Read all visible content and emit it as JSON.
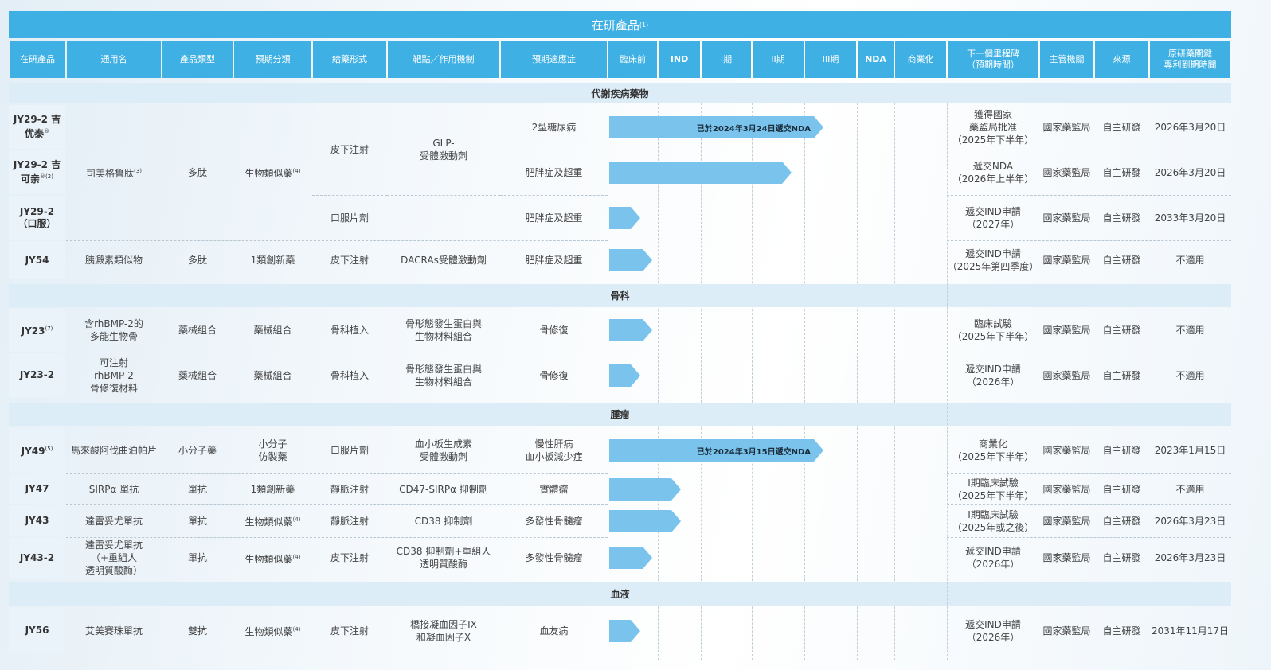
{
  "title": "在研產品",
  "title_note": "(1)",
  "headers": [
    "在研產品",
    "通用名",
    "產品類型",
    "預期分類",
    "給藥形式",
    "靶點／作用機制",
    "預期適應症",
    "臨床前",
    "IND",
    "I期",
    "II期",
    "III期",
    "NDA",
    "商業化",
    "下一個里程碑\n（預期時間）",
    "主管機關",
    "來源",
    "原研藥關鍵\n專利到期時間"
  ],
  "sections": [
    {
      "name": "代謝疾病藥物",
      "rows": [
        {
          "code": "JY29-2\n吉优泰",
          "code_sup": "®",
          "generic": "",
          "type": "",
          "class": "",
          "class_sup": "",
          "route": "",
          "target": "",
          "indication": "2型糖尿病",
          "arrow_text": "已於2024年3月24日遞交NDA",
          "progress": 0.75,
          "milestone": "獲得國家\n藥監局批准\n（2025年下半年）",
          "authority": "國家藥監局",
          "source": "自主研發",
          "patent": "2026年3月20日"
        },
        {
          "code": "JY29-2\n吉可亲",
          "code_sup": "®(2)",
          "generic": "司美格鲁肽",
          "generic_sup": "(3)",
          "type": "多肽",
          "class": "生物類似藥",
          "class_sup": "(4)",
          "route": "皮下注射",
          "target": "GLP-\n受體激動劑",
          "indication": "肥胖症及超重",
          "arrow_text": "",
          "progress": 0.64,
          "milestone": "遞交NDA\n（2026年上半年）",
          "authority": "國家藥監局",
          "source": "自主研發",
          "patent": "2026年3月20日"
        },
        {
          "code": "JY29-2\n（口服）",
          "code_sup": "",
          "generic": "",
          "type": "",
          "class": "",
          "class_sup": "",
          "route": "口服片劑",
          "target": "",
          "indication": "肥胖症及超重",
          "arrow_text": "",
          "progress": 0.11,
          "milestone": "遞交IND申請\n（2027年）",
          "authority": "國家藥監局",
          "source": "自主研發",
          "patent": "2033年3月20日"
        },
        {
          "code": "JY54",
          "code_sup": "",
          "generic": "胰澱素類似物",
          "type": "多肽",
          "class": "1類創新藥",
          "class_sup": "",
          "route": "皮下注射",
          "target": "DACRAs受體激動劑",
          "indication": "肥胖症及超重",
          "arrow_text": "",
          "progress": 0.15,
          "milestone": "遞交IND申請\n（2025年第四季度）",
          "authority": "國家藥監局",
          "source": "自主研發",
          "patent": "不適用"
        }
      ]
    },
    {
      "name": "骨科",
      "rows": [
        {
          "code": "JY23",
          "code_sup": "(7)",
          "generic": "含rhBMP-2的\n多能生物骨",
          "type": "藥械組合",
          "class": "藥械組合",
          "class_sup": "",
          "route": "骨科植入",
          "target": "骨形態發生蛋白與\n生物材料組合",
          "indication": "骨修復",
          "arrow_text": "",
          "progress": 0.15,
          "milestone": "臨床試驗\n（2025年下半年）",
          "authority": "國家藥監局",
          "source": "自主研發",
          "patent": "不適用"
        },
        {
          "code": "JY23-2",
          "code_sup": "",
          "generic": "可注射\nrhBMP-2\n骨修復材料",
          "type": "藥械組合",
          "class": "藥械組合",
          "class_sup": "",
          "route": "骨科植入",
          "target": "骨形態發生蛋白與\n生物材料組合",
          "indication": "骨修復",
          "arrow_text": "",
          "progress": 0.11,
          "milestone": "遞交IND申請\n（2026年）",
          "authority": "國家藥監局",
          "source": "自主研發",
          "patent": "不適用"
        }
      ]
    },
    {
      "name": "腫瘤",
      "rows": [
        {
          "code": "JY49",
          "code_sup": "(5)",
          "generic": "馬來酸阿伐曲泊帕片",
          "type": "小分子藥",
          "class": "小分子\n仿製藥",
          "class_sup": "",
          "route": "口服片劑",
          "target": "血小板生成素\n受體激動劑",
          "indication": "慢性肝病\n血小板減少症",
          "arrow_text": "已於2024年3月15日遞交NDA",
          "progress": 0.75,
          "milestone": "商業化\n（2025年下半年）",
          "authority": "國家藥監局",
          "source": "自主研發",
          "patent": "2023年1月15日"
        },
        {
          "code": "JY47",
          "code_sup": "",
          "generic": "SIRPα 單抗",
          "type": "單抗",
          "class": "1類創新藥",
          "class_sup": "",
          "route": "靜脈注射",
          "target": "CD47-SIRPα 抑制劑",
          "indication": "實體瘤",
          "arrow_text": "",
          "progress": 0.25,
          "milestone": "I期臨床試驗\n（2025年下半年）",
          "authority": "國家藥監局",
          "source": "自主研發",
          "patent": "不適用"
        },
        {
          "code": "JY43",
          "code_sup": "",
          "generic": "達雷妥尤單抗",
          "type": "單抗",
          "class": "生物類似藥",
          "class_sup": "(4)",
          "route": "靜脈注射",
          "target": "CD38 抑制劑",
          "indication": "多發性骨髓瘤",
          "arrow_text": "",
          "progress": 0.25,
          "milestone": "I期臨床試驗\n（2025年或之後）",
          "authority": "國家藥監局",
          "source": "自主研發",
          "patent": "2026年3月23日"
        },
        {
          "code": "JY43-2",
          "code_sup": "",
          "generic": "達雷妥尤單抗\n（+重組人\n透明質酸酶）",
          "type": "單抗",
          "class": "生物類似藥",
          "class_sup": "(4)",
          "route": "皮下注射",
          "target": "CD38 抑制劑+重組人\n透明質酸酶",
          "indication": "多發性骨髓瘤",
          "arrow_text": "",
          "progress": 0.15,
          "milestone": "遞交IND申請\n（2026年）",
          "authority": "國家藥監局",
          "source": "自主研發",
          "patent": "2026年3月23日"
        }
      ]
    },
    {
      "name": "血液",
      "rows": [
        {
          "code": "JY56",
          "code_sup": "",
          "generic": "艾美賽珠單抗",
          "type": "雙抗",
          "class": "生物類似藥",
          "class_sup": "(4)",
          "route": "皮下注射",
          "target": "橋接凝血因子IX\n和凝血因子X",
          "indication": "血友病",
          "arrow_text": "",
          "progress": 0.11,
          "milestone": "遞交IND申請\n（2026年）",
          "authority": "國家藥監局",
          "source": "自主研發",
          "patent": "2031年11月17日"
        }
      ]
    }
  ],
  "colors": {
    "header": "#3fb0e3",
    "band": "#dcedf8",
    "arrow": "#79c3ec",
    "code_bg": "#eaf3fa"
  }
}
